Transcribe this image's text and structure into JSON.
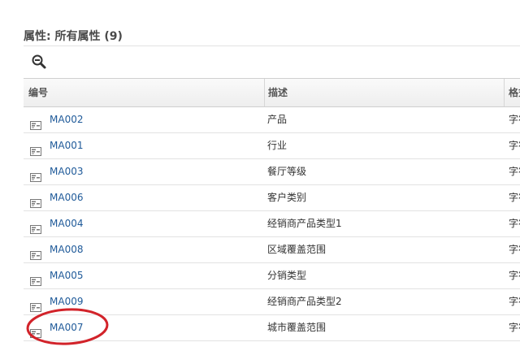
{
  "header": {
    "title": "属性: 所有属性 (9)"
  },
  "toolbar": {
    "icon": "zoom-out-icon"
  },
  "table": {
    "columns": [
      "编号",
      "描述",
      "格式"
    ],
    "rows": [
      {
        "code": "MA002",
        "desc": "产品",
        "format": "字符"
      },
      {
        "code": "MA001",
        "desc": "行业",
        "format": "字符"
      },
      {
        "code": "MA003",
        "desc": "餐厅等级",
        "format": "字符"
      },
      {
        "code": "MA006",
        "desc": "客户类别",
        "format": "字符"
      },
      {
        "code": "MA004",
        "desc": "经销商产品类型1",
        "format": "字符"
      },
      {
        "code": "MA008",
        "desc": "区域覆盖范围",
        "format": "字符"
      },
      {
        "code": "MA005",
        "desc": "分销类型",
        "format": "字符"
      },
      {
        "code": "MA009",
        "desc": "经销商产品类型2",
        "format": "字符"
      },
      {
        "code": "MA007",
        "desc": "城市覆盖范围",
        "format": "字符"
      }
    ]
  },
  "colors": {
    "link": "#1f5a99",
    "annotation": "#d2232a"
  }
}
